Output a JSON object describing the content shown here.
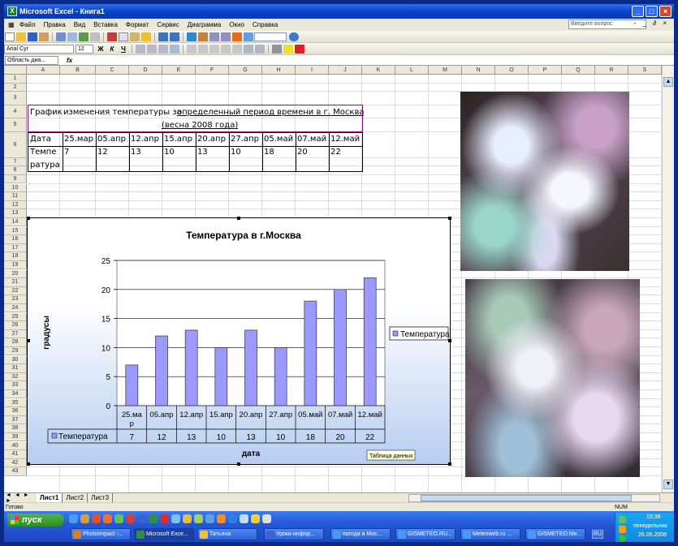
{
  "window": {
    "title": "Microsoft Excel - Книга1",
    "min": "_",
    "max": "□",
    "close": "×"
  },
  "menu": {
    "items": [
      "Файл",
      "Правка",
      "Вид",
      "Вставка",
      "Формат",
      "Сервис",
      "Диаграмма",
      "Окно",
      "Справка"
    ],
    "help_placeholder": "Введите вопрос",
    "mini_controls": "- _ ∂ ×"
  },
  "toolbar": {
    "font": "Arial Cyr",
    "size": "12",
    "bold": "Ж",
    "italic": "К",
    "underline": "Ч"
  },
  "formula": {
    "namebox": "Область диа...",
    "fx": "fx"
  },
  "columns": [
    "A",
    "B",
    "C",
    "D",
    "E",
    "F",
    "G",
    "H",
    "I",
    "J",
    "K",
    "L",
    "M",
    "N",
    "O",
    "P",
    "Q",
    "R",
    "S"
  ],
  "rows": [
    "1",
    "2",
    "3",
    "4",
    "5",
    "6",
    "7",
    "8",
    "9",
    "10",
    "11",
    "12",
    "13",
    "14",
    "15",
    "16",
    "17",
    "18",
    "19",
    "20",
    "21",
    "22",
    "23",
    "24",
    "25",
    "26",
    "27",
    "28",
    "29",
    "30",
    "31",
    "32",
    "33",
    "34",
    "35",
    "36",
    "37",
    "38",
    "39",
    "40",
    "41",
    "42",
    "43"
  ],
  "table": {
    "title_line1_a": "График",
    "title_line1_b": "изменения температуры за",
    "title_line1_c": "определенный период времени в г. Москва",
    "title_line2": "(весна 2008 года)",
    "header_label": "Дата",
    "dates": [
      "25.мар",
      "05.апр",
      "12.апр",
      "15.апр",
      "20.апр",
      "27.апр",
      "05.май",
      "07.май",
      "12.май"
    ],
    "row_label_1": "Темпе",
    "row_label_2": "ратура",
    "temps": [
      "7",
      "12",
      "13",
      "10",
      "13",
      "10",
      "18",
      "20",
      "22"
    ]
  },
  "chart_data": {
    "type": "bar",
    "title": "Температура в г.Москва",
    "xlabel": "дата",
    "ylabel": "градусы",
    "categories": [
      "25.мар",
      "05.апр",
      "12.апр",
      "15.апр",
      "20.апр",
      "27.апр",
      "05.май",
      "07.май",
      "12.май"
    ],
    "category_labels_line1": [
      "25.ма",
      "05.апр",
      "12.апр",
      "15.апр",
      "20.апр",
      "27.апр",
      "05.май",
      "07.май",
      "12.май"
    ],
    "category_labels_line2": [
      "р",
      "",
      "",
      "",
      "",
      "",
      "",
      "",
      ""
    ],
    "series": [
      {
        "name": "Температура",
        "values": [
          7,
          12,
          13,
          10,
          13,
          10,
          18,
          20,
          22
        ],
        "color": "#9999ff"
      }
    ],
    "value_labels": [
      "7",
      "12",
      "13",
      "10",
      "13",
      "10",
      "18",
      "20",
      "22"
    ],
    "ylim": [
      0,
      25
    ],
    "yticks": [
      0,
      5,
      10,
      15,
      20,
      25
    ],
    "ytick_labels": [
      "0",
      "5",
      "10",
      "15",
      "20",
      "25"
    ],
    "grid": true,
    "legend": "right",
    "data_table_label": "Температура",
    "tooltip": "Таблица данных"
  },
  "sheets": {
    "tabs": [
      "Лист1",
      "Лист2",
      "Лист3"
    ],
    "nav": "◄ ◄ ► ►"
  },
  "status": {
    "ready": "Готово",
    "num": "NUM"
  },
  "taskbar": {
    "start": "пуск",
    "tasks": [
      "PhotoImpact -...",
      "Microsoft Exce...",
      "Татьяна",
      "Уроки инфор...",
      "погода в Мос...",
      "GISMETEO.RU...",
      "Meteoweb.ru ...",
      "GISMETEO.Me..."
    ],
    "lang": "RU",
    "time": "15:38",
    "day": "понедельник",
    "date": "26.05.2008"
  }
}
